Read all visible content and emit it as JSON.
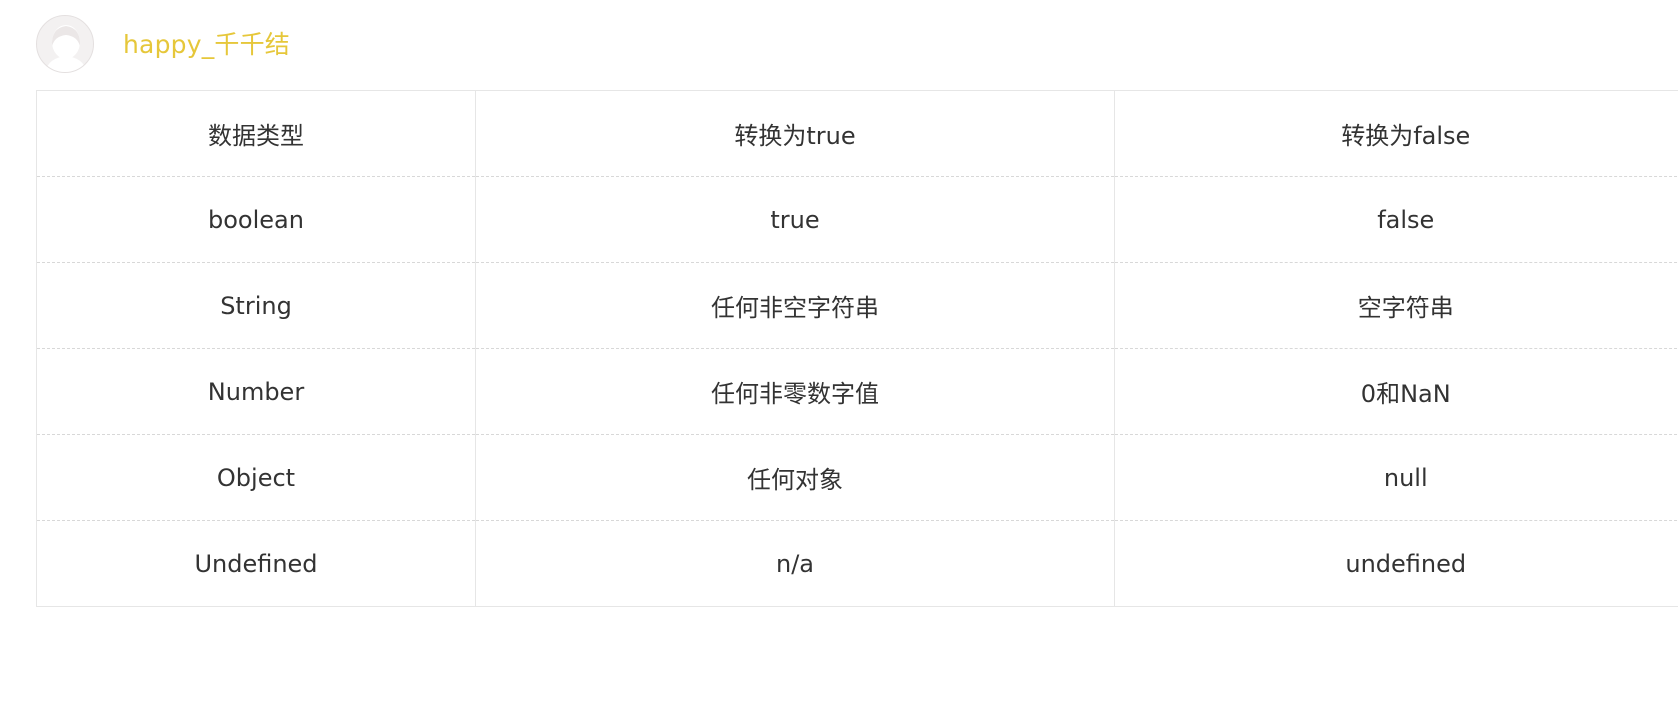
{
  "author": {
    "name": "happy_千千结",
    "name_color": "#e6c73a"
  },
  "table": {
    "headers": [
      "数据类型",
      "转换为true",
      "转换为false"
    ],
    "rows": [
      [
        "boolean",
        "true",
        "false"
      ],
      [
        "String",
        "任何非空字符串",
        "空字符串"
      ],
      [
        "Number",
        "任何非零数字值",
        "0和NaN"
      ],
      [
        "Object",
        "任何对象",
        "null"
      ],
      [
        "Undefined",
        "n/a",
        "undefined"
      ]
    ]
  }
}
